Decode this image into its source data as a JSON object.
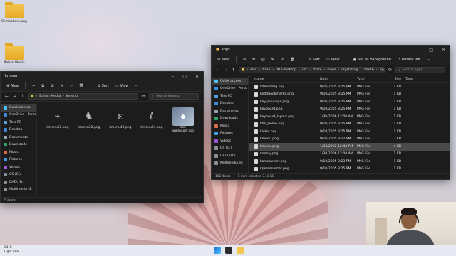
{
  "desktop": {
    "icons": [
      {
        "label": "Semaphore.png"
      },
      {
        "label": "Bahan Media"
      }
    ]
  },
  "kmenu_window": {
    "title": "kmenu",
    "toolbar": {
      "new": "New",
      "sort": "Sort",
      "view": "View"
    },
    "path": [
      "Bahan Media",
      "kmenu"
    ],
    "search_placeholder": "Search kmenu",
    "sidebar": [
      "Quick access",
      "OneDrive - Perso",
      "This PC",
      "Desktop",
      "Documents",
      "Downloads",
      "Music",
      "Pictures",
      "Videos",
      "OS (C:)",
      "DATA (D:)",
      "Multimedia (E:)"
    ],
    "files": [
      {
        "name": "kmenu22.png",
        "icon": "glyph-icon"
      },
      {
        "name": "kmenu32.png",
        "icon": "glyph-icon"
      },
      {
        "name": "kmenu48.png",
        "icon": "glyph-icon"
      },
      {
        "name": "kmenu64.png",
        "icon": "glyph-icon"
      },
      {
        "name": "slax-wallpaper.jpg",
        "icon": "image-thumb"
      }
    ],
    "status": {
      "count": "5 items"
    }
  },
  "apps_window": {
    "title": "apps",
    "toolbar": {
      "new": "New",
      "sort": "Sort",
      "view": "View",
      "set_background": "Set as background",
      "rotate_left": "Rotate left"
    },
    "path": [
      "slax",
      "base",
      "003-desktop",
      "usr",
      "share",
      "icons",
      "crystalsvg",
      "16x16",
      "apps"
    ],
    "search_placeholder": "Search apps",
    "sidebar": [
      "Quick access",
      "OneDrive - Perso",
      "This PC",
      "Desktop",
      "Documents",
      "Downloads",
      "Music",
      "Pictures",
      "Videos",
      "OS (C:)",
      "DATA (D:)",
      "Multimedia (E:)"
    ],
    "columns": {
      "name": "Name",
      "date": "Date",
      "type": "Type",
      "size": "Size",
      "tags": "Tags"
    },
    "rows": [
      {
        "name": "kdmconfig.png",
        "date": "9/10/2005 3:25 PM",
        "type": "PNG File",
        "size": "1 KB"
      },
      {
        "name": "keditbookmarks.png",
        "date": "9/10/2005 3:25 PM",
        "type": "PNG File",
        "size": "1 KB"
      },
      {
        "name": "key_bindings.png",
        "date": "9/10/2005 3:25 PM",
        "type": "PNG File",
        "size": "1 KB"
      },
      {
        "name": "keyboard.png",
        "date": "9/10/2005 3:25 PM",
        "type": "PNG File",
        "size": "1 KB"
      },
      {
        "name": "keyboard_layout.png",
        "date": "1/30/2006 12:00 AM",
        "type": "PNG File",
        "size": "1 KB"
      },
      {
        "name": "kfm_home.png",
        "date": "9/10/2005 3:25 PM",
        "type": "PNG File",
        "size": "1 KB"
      },
      {
        "name": "kicker.png",
        "date": "9/10/2005 3:25 PM",
        "type": "PNG File",
        "size": "1 KB"
      },
      {
        "name": "kmenu.png",
        "date": "9/10/2005 3:27 PM",
        "type": "PNG File",
        "size": "2 KB"
      },
      {
        "name": "kmenu.png",
        "date": "1/30/2022 12:40 PM",
        "type": "PNG File",
        "size": "4 KB"
      },
      {
        "name": "knotify.png",
        "date": "1/30/2006 12:00 AM",
        "type": "PNG File",
        "size": "1 KB"
      },
      {
        "name": "kommander.png",
        "date": "9/10/2005 3:23 PM",
        "type": "PNG File",
        "size": "1 KB"
      },
      {
        "name": "kpersonalizer.png",
        "date": "9/10/2005 3:25 PM",
        "type": "PNG File",
        "size": "1 KB"
      }
    ],
    "selected_row": 8,
    "status": {
      "count": "162 items",
      "selection": "1 item selected  3.10 KB"
    }
  },
  "taskbar": {
    "weather_temp": "24°C",
    "weather_desc": "Light rain"
  },
  "colors": {
    "accent": "#4cc2ff",
    "folder": "#f3c54f"
  }
}
